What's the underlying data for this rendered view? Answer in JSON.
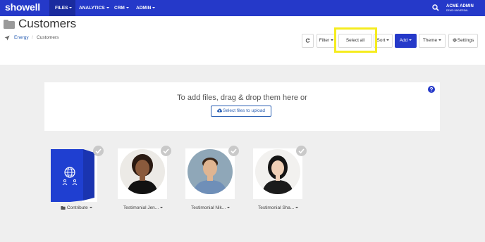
{
  "brand": {
    "logo": "showell",
    "accent": "#2539c9",
    "highlight": "#f5ec1f"
  },
  "nav": {
    "items": [
      {
        "label": "FILES",
        "active": true
      },
      {
        "label": "ANALYTICS"
      },
      {
        "label": "CRM"
      },
      {
        "label": "ADMIN"
      }
    ],
    "user": {
      "name": "ACME ADMIN",
      "org": "DEMO UNIVERSAL"
    }
  },
  "page": {
    "title": "Customers",
    "breadcrumb": [
      "Energy",
      "Customers"
    ],
    "breadcrumb_sep": "/"
  },
  "toolbar": {
    "filter": "Filter",
    "select_all": "Select all",
    "sort": "Sort",
    "add": "Add",
    "theme": "Theme",
    "settings": "Settings"
  },
  "dropzone": {
    "text": "To add files, drag & drop them here or",
    "button": "Select files to upload"
  },
  "files": [
    {
      "label": "Contribute",
      "type": "folder"
    },
    {
      "label": "Testimonial Jen..."
    },
    {
      "label": "Testimonial Nik..."
    },
    {
      "label": "Testimonial Sha..."
    }
  ]
}
